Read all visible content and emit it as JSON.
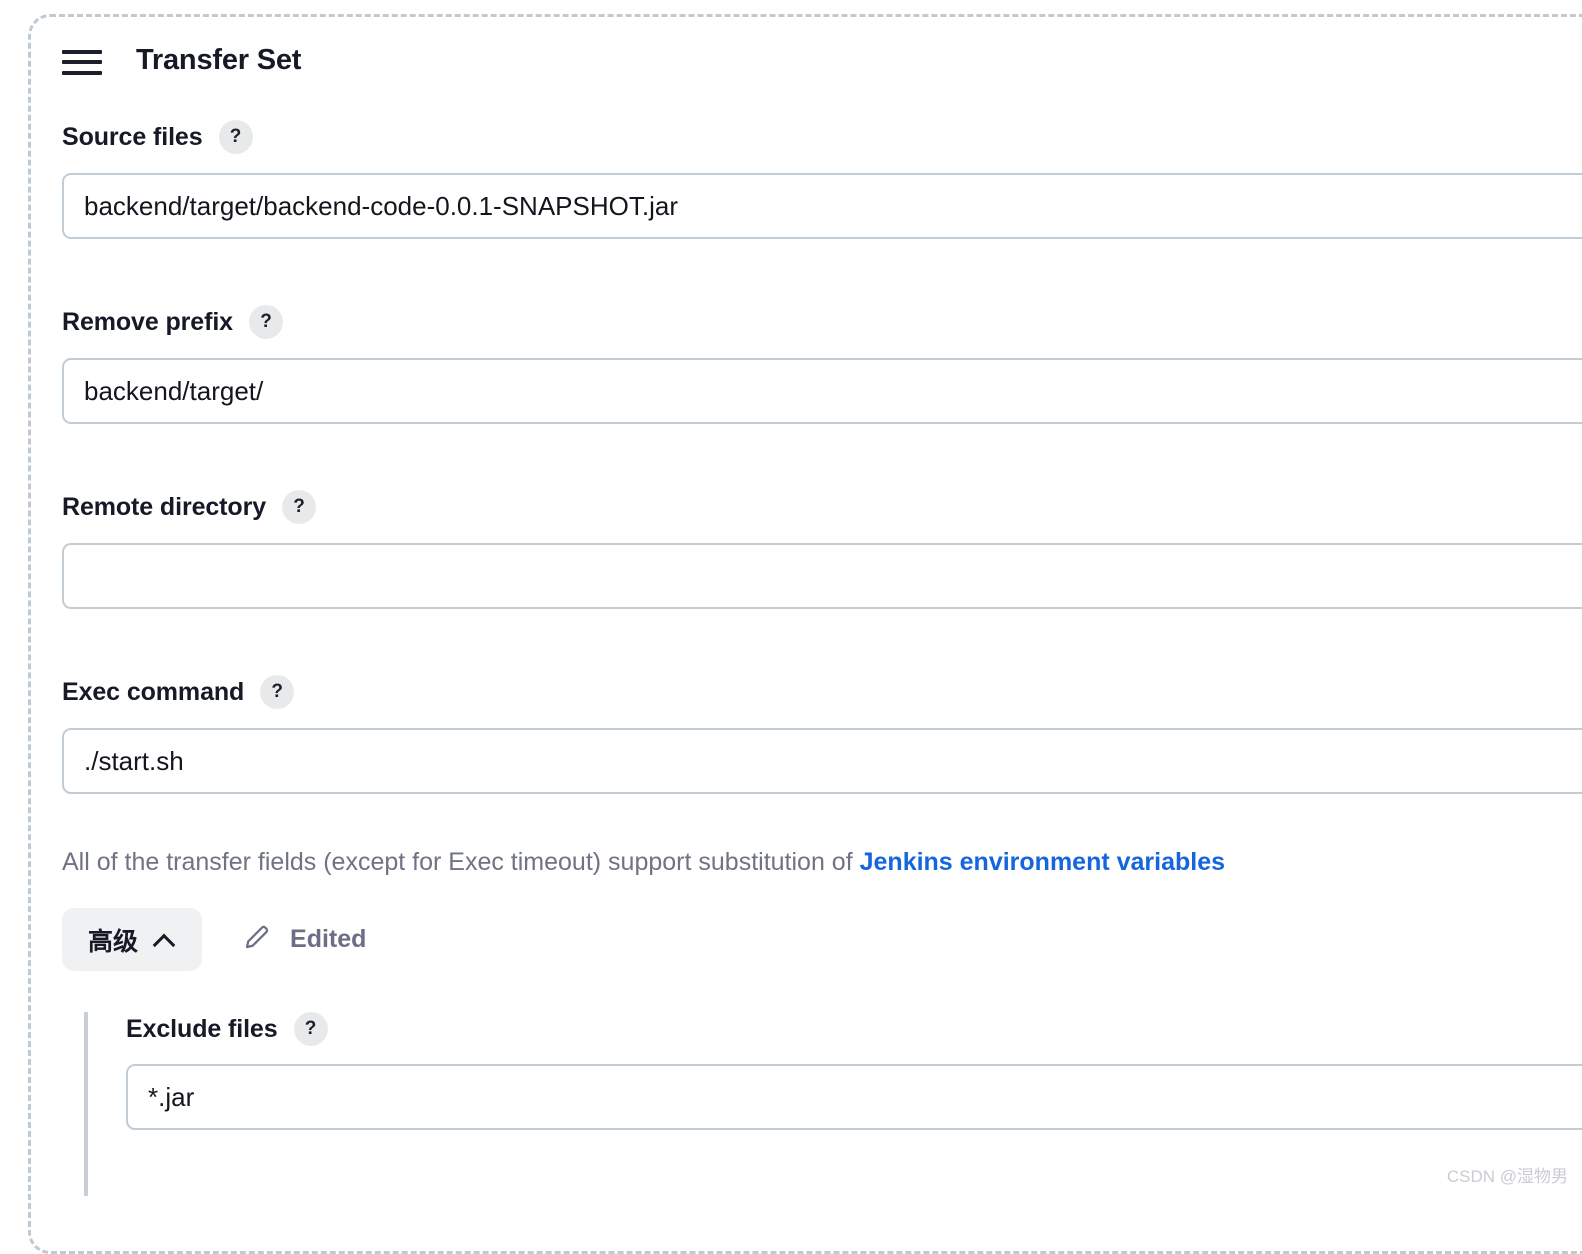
{
  "header": {
    "menu_icon": "hamburger-icon",
    "title": "Transfer Set"
  },
  "fields": [
    {
      "label": "Source files",
      "help": "?",
      "value": "backend/target/backend-code-0.0.1-SNAPSHOT.jar",
      "placeholder": ""
    },
    {
      "label": "Remove prefix",
      "help": "?",
      "value": "backend/target/",
      "placeholder": ""
    },
    {
      "label": "Remote directory",
      "help": "?",
      "value": "",
      "placeholder": ""
    },
    {
      "label": "Exec command",
      "help": "?",
      "value": "./start.sh",
      "placeholder": ""
    }
  ],
  "helper": {
    "text_before": "All of the transfer fields (except for Exec timeout) support substitution of ",
    "link_text": "Jenkins environment variables"
  },
  "advanced": {
    "button_label": "高级",
    "chevron_icon": "chevron-up-icon",
    "edited_icon": "pencil-icon",
    "edited_label": "Edited",
    "exclude": {
      "label": "Exclude files",
      "help": "?",
      "value": "*.jar",
      "placeholder": ""
    }
  },
  "watermark": "CSDN @湿物男",
  "colors": {
    "accent_link": "#1566dd",
    "input_border": "#c2ccd4",
    "text_primary": "#161a26",
    "text_muted": "#6f7383",
    "badge_bg": "#e8e9eb",
    "advanced_btn_bg": "#f0f1f3",
    "dashed_frame": "#c0cad3"
  }
}
